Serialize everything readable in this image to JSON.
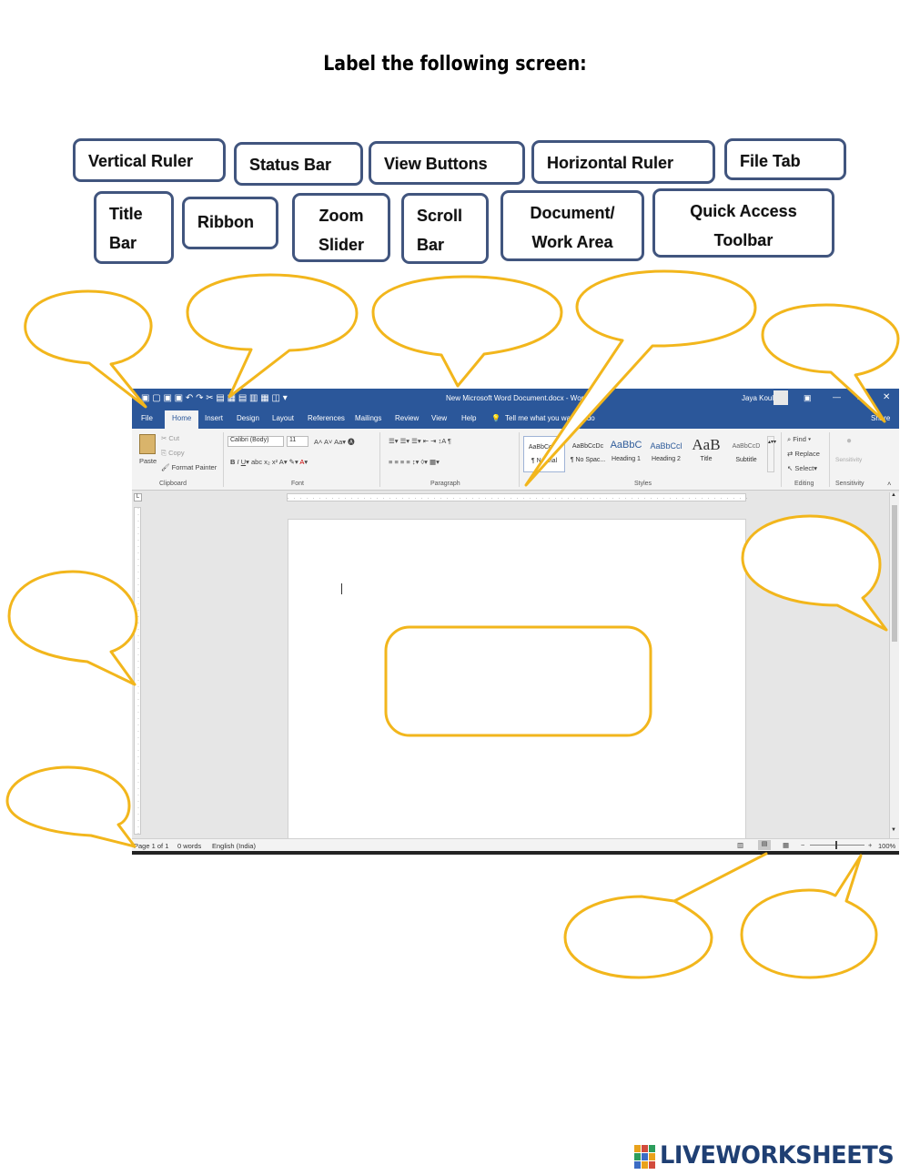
{
  "worksheet": {
    "title": "Label the following screen:",
    "labels": [
      {
        "id": "vertical-ruler",
        "text": "Vertical Ruler"
      },
      {
        "id": "status-bar",
        "text": "Status Bar"
      },
      {
        "id": "view-buttons",
        "text": "View Buttons"
      },
      {
        "id": "horizontal-ruler",
        "text": "Horizontal Ruler"
      },
      {
        "id": "file-tab",
        "text": "File Tab"
      },
      {
        "id": "title-bar",
        "line1": "Title",
        "line2": "Bar"
      },
      {
        "id": "ribbon",
        "text": "Ribbon"
      },
      {
        "id": "zoom-slider",
        "line1": "Zoom",
        "line2": "Slider"
      },
      {
        "id": "scroll-bar",
        "line1": "Scroll",
        "line2": "Bar"
      },
      {
        "id": "document-work-area",
        "line1": "Document/",
        "line2": "Work Area"
      },
      {
        "id": "quick-access-toolbar",
        "line1": "Quick Access",
        "line2": "Toolbar"
      }
    ]
  },
  "word": {
    "title": "New Microsoft Word Document.docx - Word",
    "user": "Jaya Koul",
    "tabs": [
      "File",
      "Home",
      "Insert",
      "Design",
      "Layout",
      "References",
      "Mailings",
      "Review",
      "View",
      "Help"
    ],
    "tell_me": "Tell me what you want to do",
    "share": "Share",
    "clipboard": {
      "paste": "Paste",
      "cut": "Cut",
      "copy": "Copy",
      "format_painter": "Format Painter",
      "group": "Clipboard"
    },
    "font": {
      "name": "Calibri (Body)",
      "size": "11",
      "group": "Font"
    },
    "paragraph_group": "Paragraph",
    "styles": {
      "items": [
        {
          "sample": "AaBbCcDc",
          "name": "¶ Normal"
        },
        {
          "sample": "AaBbCcDc",
          "name": "¶ No Spac..."
        },
        {
          "sample": "AaBbC",
          "name": "Heading 1"
        },
        {
          "sample": "AaBbCcl",
          "name": "Heading 2"
        },
        {
          "sample": "AaB",
          "name": "Title"
        },
        {
          "sample": "AaBbCcD",
          "name": "Subtitle"
        }
      ],
      "group": "Styles"
    },
    "editing": {
      "find": "Find",
      "replace": "Replace",
      "select": "Select",
      "group": "Editing"
    },
    "sensitivity": {
      "label": "Sensitivity",
      "group": "Sensitivity"
    },
    "status": {
      "page": "Page 1 of 1",
      "words": "0 words",
      "language": "English (India)",
      "zoom": "100%"
    }
  },
  "branding": {
    "logo": "LIVEWORKSHEETS"
  },
  "colors": {
    "word_blue": "#2b579a",
    "bubble": "#f2b61c",
    "label_border": "#41557e",
    "logo": "#1f3f73"
  }
}
